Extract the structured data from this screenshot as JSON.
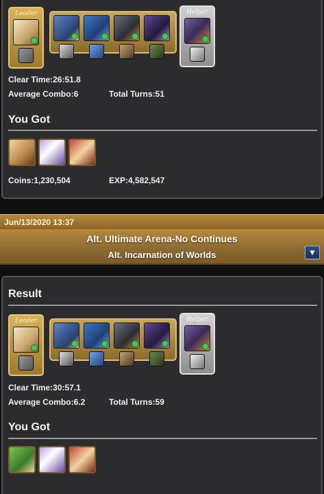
{
  "entry1": {
    "team": {
      "leader_tag": "Leader",
      "helper_tag": "Helper",
      "leader_portrait": "white-haired-leader-portrait",
      "subs": [
        "blue-dragon-portrait",
        "blue-warrior-portrait",
        "dark-knight-portrait",
        "dark-mage-portrait"
      ],
      "helper_portrait": "armored-hero-portrait"
    },
    "clear_time": "Clear Time:26:51.8",
    "average_combo": "Average Combo:6",
    "total_turns": "Total Turns:51",
    "you_got": "You Got",
    "drops": [
      "beast-drop-portrait",
      "crystal-drop-portrait",
      "red-flower-drop-portrait"
    ],
    "coins": "Coins:1,230,504",
    "exp": "EXP:4,582,547"
  },
  "dungeon": {
    "date": "Jun/13/2020 13:37",
    "name": "Alt. Ultimate Arena-No Continues",
    "floor": "Alt. Incarnation of Worlds",
    "expand_icon": "triangle-down-icon"
  },
  "entry2": {
    "result_title": "Result",
    "team": {
      "leader_tag": "Leader",
      "helper_tag": "Helper"
    },
    "clear_time": "Clear Time:30:57.1",
    "average_combo": "Average Combo:6.2",
    "total_turns": "Total Turns:59",
    "you_got": "You Got",
    "drops": [
      "green-dragon-drop-portrait",
      "crystal-drop-portrait",
      "red-flower-drop-portrait"
    ]
  },
  "colors": {
    "panel_bg": "#2c2c2e",
    "gold_accent": "#b58a3c",
    "helper_silver": "#c8c8c8",
    "expand_button": "#1a2e5a"
  }
}
